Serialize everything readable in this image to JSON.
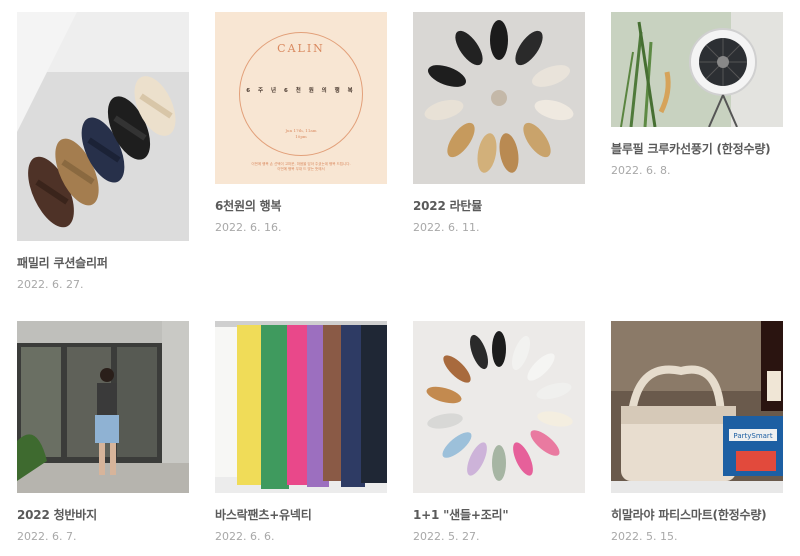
{
  "posts": [
    {
      "title": "패밀리 쿠션슬리퍼",
      "date": "2022. 6. 27."
    },
    {
      "title": "6천원의 행복",
      "date": "2022. 6. 16."
    },
    {
      "title": "2022 라탄뮬",
      "date": "2022. 6. 11."
    },
    {
      "title": "블루필 크루카선풍기 (한정수량)",
      "date": "2022. 6. 8."
    },
    {
      "title": "2022 청반바지",
      "date": "2022. 6. 7."
    },
    {
      "title": "바스락팬츠+유넥티",
      "date": "2022. 6. 6."
    },
    {
      "title": "1+1 \"샌들+조리\"",
      "date": "2022. 5. 27."
    },
    {
      "title": "히말라야 파티스마트(한정수량)",
      "date": "2022. 5. 15."
    }
  ],
  "poster": {
    "brand": "CALIN",
    "headline": "6 주 년 6 천 원 의 행 복",
    "date_line1": "Jun 17th, 11am",
    "date_line2": "10pm",
    "footer_line1": "이번에 행복 손 선택이 고마운, 마음을 담아 주셨는데 행복 드립니다.",
    "footer_line2": "이번에 행복 무대 드 맞는 뜻에서"
  },
  "photo_labels": {
    "fan_stand_brand": "",
    "party_box": "PartySmart"
  },
  "colors": {
    "title": "#5a5a5a",
    "date": "#a8a8a8",
    "poster_bg": "#f8e6d3",
    "poster_accent": "#d9895f"
  }
}
